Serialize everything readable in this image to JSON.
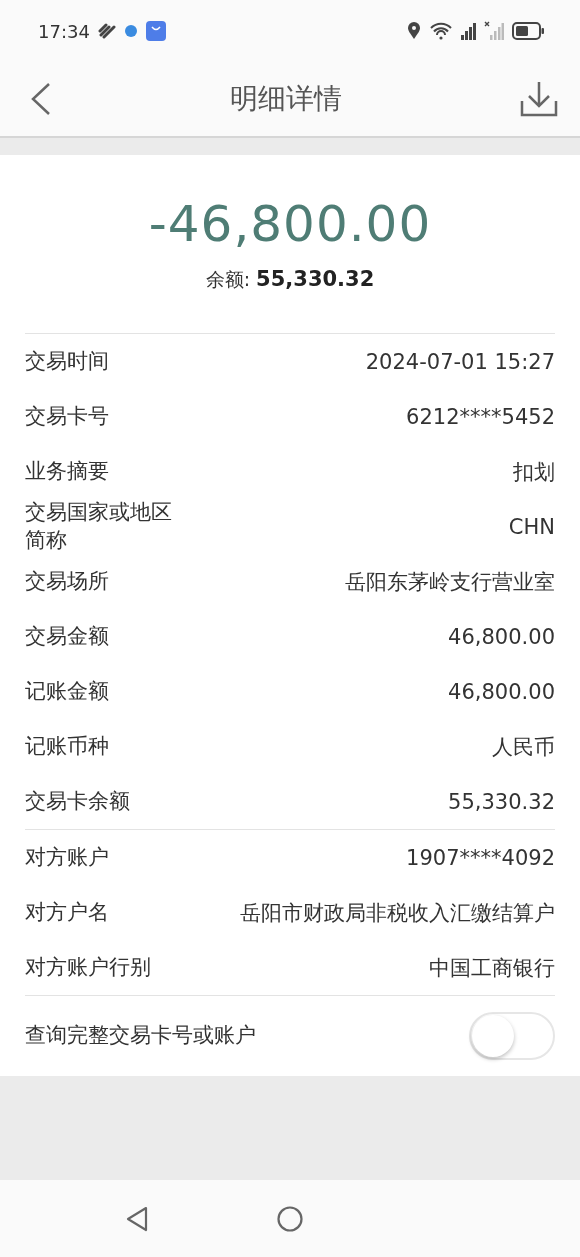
{
  "status_bar": {
    "time": "17:34"
  },
  "header": {
    "title": "明细详情"
  },
  "summary": {
    "amount": "-46,800.00",
    "balance_label": "余额:",
    "balance": "55,330.32"
  },
  "groups": [
    {
      "rows": [
        {
          "label": "交易时间",
          "value": "2024-07-01 15:27"
        },
        {
          "label": "交易卡号",
          "value": "6212****5452"
        },
        {
          "label": "业务摘要",
          "value": "扣划"
        },
        {
          "label": "交易国家或地区简称",
          "value": "CHN"
        },
        {
          "label": "交易场所",
          "value": "岳阳东茅岭支行营业室"
        },
        {
          "label": "交易金额",
          "value": "46,800.00"
        },
        {
          "label": "记账金额",
          "value": "46,800.00"
        },
        {
          "label": "记账币种",
          "value": "人民币"
        },
        {
          "label": "交易卡余额",
          "value": "55,330.32"
        }
      ]
    },
    {
      "rows": [
        {
          "label": "对方账户",
          "value": "1907****4092"
        },
        {
          "label": "对方户名",
          "value": "岳阳市财政局非税收入汇缴结算户"
        },
        {
          "label": "对方账户行别",
          "value": "中国工商银行"
        }
      ]
    }
  ],
  "toggle": {
    "label": "查询完整交易卡号或账户",
    "on": false
  }
}
